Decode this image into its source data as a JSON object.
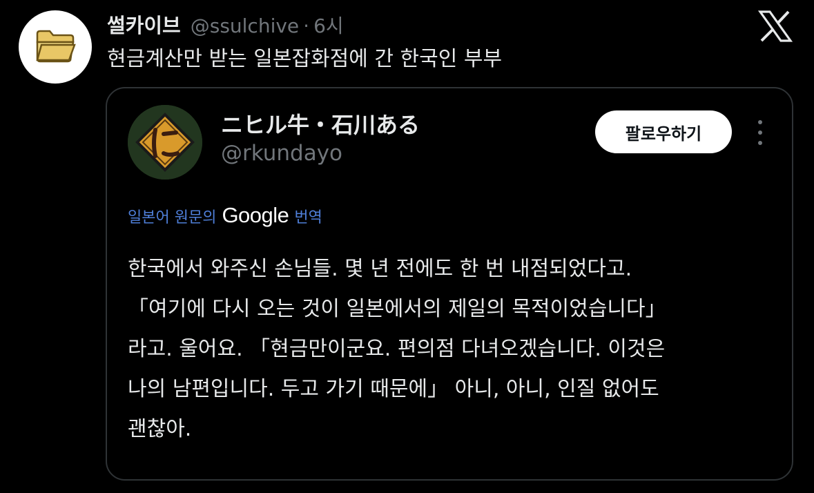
{
  "post": {
    "display_name": "썰카이브",
    "handle": "@ssulchive",
    "separator": "·",
    "time": "6시",
    "text": "현금계산만 받는 일본잡화점에 간 한국인 부부"
  },
  "quote": {
    "display_name": "ニヒル牛・石川ある",
    "handle": "@rkundayo",
    "follow_label": "팔로우하기",
    "translation": {
      "prefix": "일본어 원문의",
      "brand": "Google",
      "suffix": "번역"
    },
    "lines": [
      "한국에서 와주신 손님들. 몇 년 전에도 한 번 내점되었다고.",
      "「여기에 다시 오는 것이 일본에서의 제일의 목적이었습니다」",
      "라고. 울어요. 「현금만이군요. 편의점 다녀오겠습니다. 이것은",
      "나의 남편입니다. 두고 가기 때문에」 아니, 아니, 인질 없어도",
      "괜찮아."
    ]
  },
  "colors": {
    "background": "#000000",
    "text_primary": "#e7e9ea",
    "text_secondary": "#71767b",
    "translate_blue": "#4f7fd9",
    "folder_icon": "#e8c766"
  },
  "icons": {
    "avatar": "folder-icon",
    "brand": "x-logo-icon",
    "more": "more-vertical-icon"
  }
}
